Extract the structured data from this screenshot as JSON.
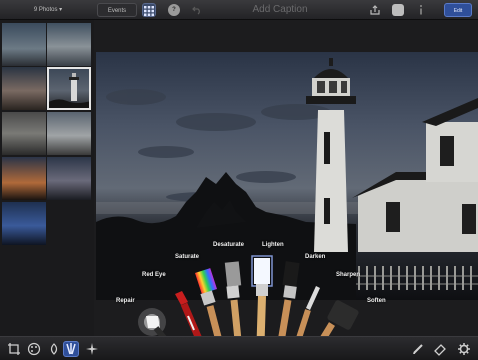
{
  "toolbar": {
    "photos_label": "9 Photos ▾",
    "events_label": "Events",
    "title": "Add Caption",
    "help_label": "?",
    "edit_label": "Edit"
  },
  "icons": {
    "grid": "grid-icon",
    "help": "help-icon",
    "undo": "undo-icon",
    "share": "share-icon",
    "tool_square": "tool-icon",
    "info": "info-icon",
    "crop": "crop-icon",
    "color": "color-palette-icon",
    "brushes": "brushes-icon",
    "effects": "effects-icon",
    "brush_edit": "brush-edit-icon",
    "eraser": "eraser-icon",
    "settings": "gear-icon"
  },
  "thumbnails": [
    {
      "name": "thumb-1",
      "selected": false
    },
    {
      "name": "thumb-2",
      "selected": false
    },
    {
      "name": "thumb-3",
      "selected": false
    },
    {
      "name": "thumb-4",
      "selected": true
    },
    {
      "name": "thumb-5",
      "selected": false
    },
    {
      "name": "thumb-6",
      "selected": false
    },
    {
      "name": "thumb-7",
      "selected": false
    },
    {
      "name": "thumb-8",
      "selected": false
    },
    {
      "name": "thumb-9",
      "selected": false
    }
  ],
  "brushes": {
    "repair": "Repair",
    "red_eye": "Red Eye",
    "saturate": "Saturate",
    "desaturate": "Desaturate",
    "lighten": "Lighten",
    "darken": "Darken",
    "sharpen": "Sharpen",
    "soften": "Soften"
  },
  "colors": {
    "accent": "#2f4f9a",
    "toolbar": "#2a2a2d",
    "label": "#f2f2f2"
  }
}
